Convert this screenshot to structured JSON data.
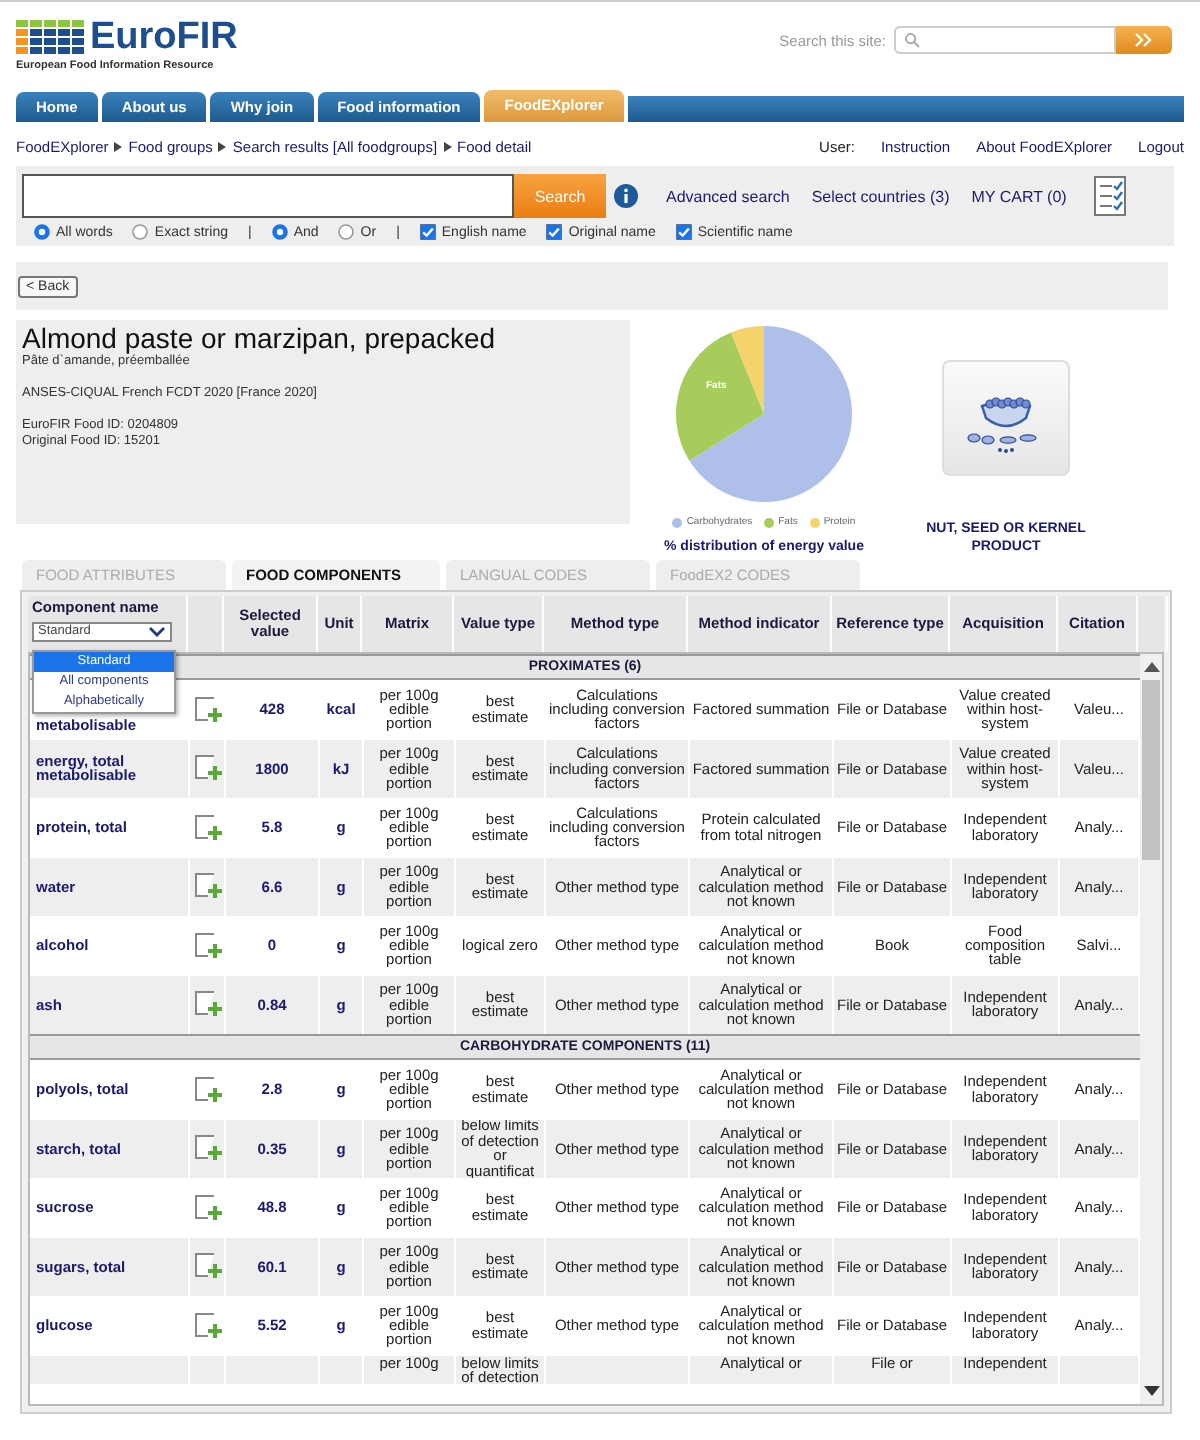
{
  "logo": {
    "name": "EuroFIR",
    "tagline": "European Food Information Resource"
  },
  "site_search": {
    "label": "Search this site:"
  },
  "nav": [
    {
      "label": "Home",
      "selected": false
    },
    {
      "label": "About us",
      "selected": false
    },
    {
      "label": "Why join",
      "selected": false
    },
    {
      "label": "Food information",
      "selected": false
    },
    {
      "label": "FoodEXplorer",
      "selected": true
    }
  ],
  "breadcrumb": [
    "FoodEXplorer",
    "Food groups",
    "Search results [All foodgroups]",
    "Food detail"
  ],
  "user_links": [
    "User:",
    "Instruction",
    "About FoodEXplorer",
    "Logout"
  ],
  "search": {
    "button": "Search",
    "links": [
      "Advanced search",
      "Select countries (3)",
      "MY CART (0)"
    ],
    "options": [
      {
        "kind": "radio",
        "label": "All words",
        "selected": true
      },
      {
        "kind": "radio",
        "label": "Exact string",
        "selected": false
      },
      {
        "kind": "sep",
        "label": "|"
      },
      {
        "kind": "radio",
        "label": "And",
        "selected": true
      },
      {
        "kind": "radio",
        "label": "Or",
        "selected": false
      },
      {
        "kind": "sep",
        "label": "|"
      },
      {
        "kind": "check",
        "label": "English name",
        "checked": true
      },
      {
        "kind": "check",
        "label": "Original name",
        "checked": true
      },
      {
        "kind": "check",
        "label": "Scientific name",
        "checked": true
      }
    ]
  },
  "back": "< Back",
  "food": {
    "title": "Almond paste or marzipan, prepacked",
    "original_name": "Pâte d`amande, préemballée",
    "source": "ANSES-CIQUAL French FCDT 2020 [France 2020]",
    "ids": [
      "EuroFIR Food ID: 0204809",
      "Original Food ID: 15201"
    ]
  },
  "energy_chart": {
    "slice_label": "Fats",
    "legend": [
      {
        "label": "Carbohydrates",
        "color": "#aec0ea"
      },
      {
        "label": "Fats",
        "color": "#a8cc5c"
      },
      {
        "label": "Protein",
        "color": "#f5d36b"
      }
    ],
    "caption": "% distribution of energy value"
  },
  "category": "NUT, SEED OR KERNEL PRODUCT",
  "tabs": [
    {
      "label": "FOOD ATTRIBUTES",
      "selected": false
    },
    {
      "label": "FOOD COMPONENTS",
      "selected": true
    },
    {
      "label": "LANGUAL CODES",
      "selected": false
    },
    {
      "label": "FoodEX2 CODES",
      "selected": false
    }
  ],
  "table": {
    "columns": [
      "Component name",
      "",
      "Selected value",
      "Unit",
      "Matrix",
      "Value type",
      "Method type",
      "Method indicator",
      "Reference type",
      "Acquisition",
      "Citation"
    ],
    "filter": {
      "value": "Standard",
      "options": [
        {
          "label": "Standard",
          "selected": true
        },
        {
          "label": "All components",
          "selected": false
        },
        {
          "label": "Alphabetically",
          "selected": false
        }
      ]
    },
    "rows": [
      {
        "kind": "section",
        "label": "PROXIMATES (6)"
      },
      {
        "kind": "food",
        "name": "metabolisable",
        "value": "428",
        "unit": "kcal",
        "matrix": "per 100g edible portion",
        "value_type": "best estimate",
        "method_type": "Calculations including conversion factors",
        "method_indicator": "Factored summation",
        "reference_type": "File or Database",
        "acquisition": "Value created within host-system",
        "citation": "Valeu..."
      },
      {
        "kind": "food",
        "name": "energy, total metabolisable",
        "value": "1800",
        "unit": "kJ",
        "matrix": "per 100g edible portion",
        "value_type": "best estimate",
        "method_type": "Calculations including conversion factors",
        "method_indicator": "Factored summation",
        "reference_type": "File or Database",
        "acquisition": "Value created within host-system",
        "citation": "Valeu..."
      },
      {
        "kind": "food",
        "name": "protein, total",
        "value": "5.8",
        "unit": "g",
        "matrix": "per 100g edible portion",
        "value_type": "best estimate",
        "method_type": "Calculations including conversion factors",
        "method_indicator": "Protein calculated from total nitrogen",
        "reference_type": "File or Database",
        "acquisition": "Independent laboratory",
        "citation": "Analy..."
      },
      {
        "kind": "food",
        "name": "water",
        "value": "6.6",
        "unit": "g",
        "matrix": "per 100g edible portion",
        "value_type": "best estimate",
        "method_type": "Other method type",
        "method_indicator": "Analytical or calculation method not known",
        "reference_type": "File or Database",
        "acquisition": "Independent laboratory",
        "citation": "Analy..."
      },
      {
        "kind": "food",
        "name": "alcohol",
        "value": "0",
        "unit": "g",
        "matrix": "per 100g edible portion",
        "value_type": "logical zero",
        "method_type": "Other method type",
        "method_indicator": "Analytical or calculation method not known",
        "reference_type": "Book",
        "acquisition": "Food composition table",
        "citation": "Salvi..."
      },
      {
        "kind": "food",
        "name": "ash",
        "value": "0.84",
        "unit": "g",
        "matrix": "per 100g edible portion",
        "value_type": "best estimate",
        "method_type": "Other method type",
        "method_indicator": "Analytical or calculation method not known",
        "reference_type": "File or Database",
        "acquisition": "Independent laboratory",
        "citation": "Analy..."
      },
      {
        "kind": "section",
        "label": "CARBOHYDRATE COMPONENTS (11)"
      },
      {
        "kind": "food",
        "name": "polyols, total",
        "value": "2.8",
        "unit": "g",
        "matrix": "per 100g edible portion",
        "value_type": "best estimate",
        "method_type": "Other method type",
        "method_indicator": "Analytical or calculation method not known",
        "reference_type": "File or Database",
        "acquisition": "Independent laboratory",
        "citation": "Analy..."
      },
      {
        "kind": "food",
        "name": "starch, total",
        "value": "0.35",
        "unit": "g",
        "matrix": "per 100g edible portion",
        "value_type": "below limits of detection or quantificat",
        "method_type": "Other method type",
        "method_indicator": "Analytical or calculation method not known",
        "reference_type": "File or Database",
        "acquisition": "Independent laboratory",
        "citation": "Analy..."
      },
      {
        "kind": "food",
        "name": "sucrose",
        "value": "48.8",
        "unit": "g",
        "matrix": "per 100g edible portion",
        "value_type": "best estimate",
        "method_type": "Other method type",
        "method_indicator": "Analytical or calculation method not known",
        "reference_type": "File or Database",
        "acquisition": "Independent laboratory",
        "citation": "Analy..."
      },
      {
        "kind": "food",
        "name": "sugars, total",
        "value": "60.1",
        "unit": "g",
        "matrix": "per 100g edible portion",
        "value_type": "best estimate",
        "method_type": "Other method type",
        "method_indicator": "Analytical or calculation method not known",
        "reference_type": "File or Database",
        "acquisition": "Independent laboratory",
        "citation": "Analy..."
      },
      {
        "kind": "food",
        "name": "glucose",
        "value": "5.52",
        "unit": "g",
        "matrix": "per 100g edible portion",
        "value_type": "best estimate",
        "method_type": "Other method type",
        "method_indicator": "Analytical or calculation method not known",
        "reference_type": "File or Database",
        "acquisition": "Independent laboratory",
        "citation": "Analy..."
      },
      {
        "kind": "cut",
        "matrix": "per 100g",
        "value_type": "below limits of detection",
        "method_indicator": "Analytical or",
        "reference_type": "File or",
        "acquisition": "Independent"
      }
    ]
  }
}
